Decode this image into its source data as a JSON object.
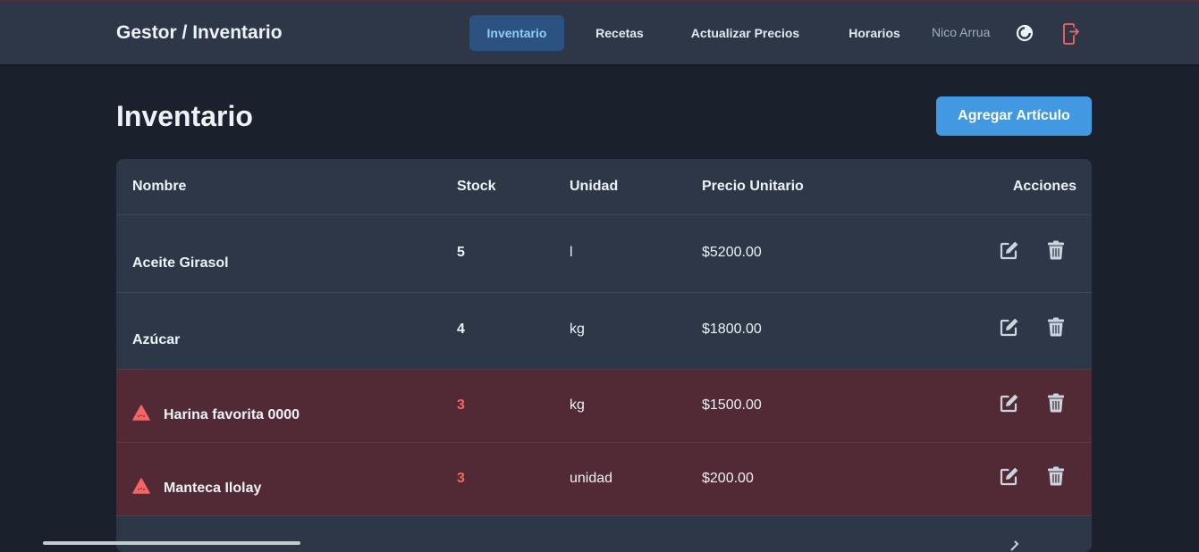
{
  "navbar": {
    "brand": "Gestor / Inventario",
    "links": [
      {
        "label": "Inventario",
        "active": true
      },
      {
        "label": "Recetas",
        "active": false
      },
      {
        "label": "Actualizar Precios",
        "active": false
      },
      {
        "label": "Horarios",
        "active": false
      }
    ],
    "user_name": "Nico Arrua",
    "theme_icon": "contrast-circle-icon",
    "logout_icon": "logout-icon"
  },
  "page": {
    "title": "Inventario",
    "add_button": "Agregar Artículo"
  },
  "table": {
    "headers": [
      "Nombre",
      "Stock",
      "Unidad",
      "Precio Unitario",
      "Acciones"
    ],
    "rows": [
      {
        "name": "Aceite Girasol",
        "stock": "5",
        "unit": "l",
        "price": "$5200.00",
        "low_stock": false
      },
      {
        "name": "Azúcar",
        "stock": "4",
        "unit": "kg",
        "price": "$1800.00",
        "low_stock": false
      },
      {
        "name": "Harina favorita 0000",
        "stock": "3",
        "unit": "kg",
        "price": "$1500.00",
        "low_stock": true
      },
      {
        "name": "Manteca Ilolay",
        "stock": "3",
        "unit": "unidad",
        "price": "$200.00",
        "low_stock": true
      }
    ]
  },
  "colors": {
    "background": "#1a202c",
    "surface": "#2d3748",
    "accent": "#4299e1",
    "active_nav": "#2c5282",
    "warning_row": "#522a35",
    "danger": "#f56565"
  }
}
